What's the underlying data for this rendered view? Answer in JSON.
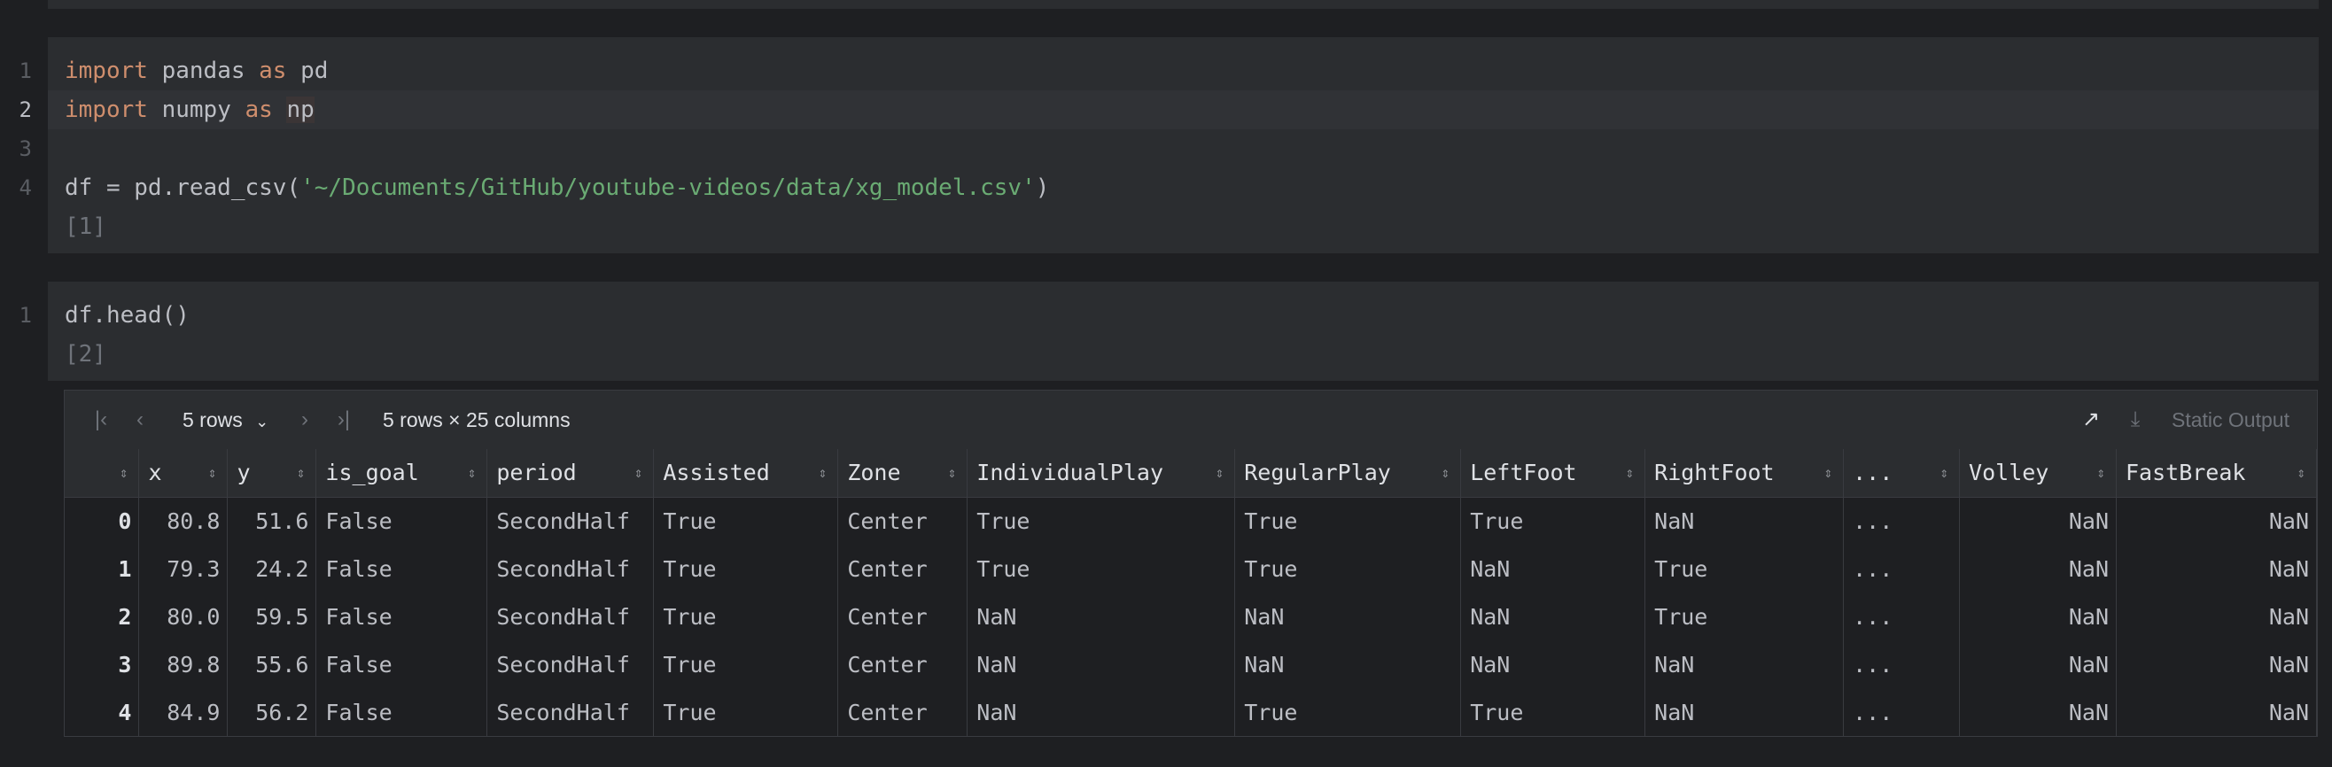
{
  "cell1": {
    "lines": [
      {
        "num": "1",
        "tokens": [
          [
            "kw",
            "import"
          ],
          [
            "",
            "pandas "
          ],
          [
            "kw",
            "as"
          ],
          [
            "",
            "pd"
          ]
        ]
      },
      {
        "num": "2",
        "tokens": [
          [
            "kw",
            "import"
          ],
          [
            "",
            "numpy "
          ],
          [
            "kw",
            "as"
          ],
          [
            "np",
            "np"
          ]
        ]
      },
      {
        "num": "3",
        "tokens": []
      },
      {
        "num": "4",
        "tokens": [
          [
            "",
            "df = pd.read_csv("
          ],
          [
            "str",
            "'~/Documents/GitHub/youtube-videos/data/xg_model.csv'"
          ],
          [
            "",
            ")"
          ]
        ]
      }
    ],
    "exec_count": "[1]"
  },
  "cell2": {
    "lines": [
      {
        "num": "1",
        "tokens": [
          [
            "",
            "df.head()"
          ]
        ]
      }
    ],
    "exec_count": "[2]"
  },
  "output": {
    "rows_selector": "5 rows",
    "shape_text": "5 rows × 25 columns",
    "static_output_label": "Static Output",
    "columns": [
      "",
      "x",
      "y",
      "is_goal",
      "period",
      "Assisted",
      "Zone",
      "IndividualPlay",
      "RegularPlay",
      "LeftFoot",
      "RightFoot",
      "...",
      "Volley",
      "FastBreak"
    ],
    "rows": [
      [
        "0",
        "80.8",
        "51.6",
        "False",
        "SecondHalf",
        "True",
        "Center",
        "True",
        "True",
        "True",
        "NaN",
        "...",
        "NaN",
        "NaN"
      ],
      [
        "1",
        "79.3",
        "24.2",
        "False",
        "SecondHalf",
        "True",
        "Center",
        "True",
        "True",
        "NaN",
        "True",
        "...",
        "NaN",
        "NaN"
      ],
      [
        "2",
        "80.0",
        "59.5",
        "False",
        "SecondHalf",
        "True",
        "Center",
        "NaN",
        "NaN",
        "NaN",
        "True",
        "...",
        "NaN",
        "NaN"
      ],
      [
        "3",
        "89.8",
        "55.6",
        "False",
        "SecondHalf",
        "True",
        "Center",
        "NaN",
        "NaN",
        "NaN",
        "NaN",
        "...",
        "NaN",
        "NaN"
      ],
      [
        "4",
        "84.9",
        "56.2",
        "False",
        "SecondHalf",
        "True",
        "Center",
        "NaN",
        "True",
        "True",
        "NaN",
        "...",
        "NaN",
        "NaN"
      ]
    ]
  },
  "icons": {
    "first_page": "first-page-icon",
    "prev_page": "prev-page-icon",
    "next_page": "next-page-icon",
    "last_page": "last-page-icon",
    "open_external": "open-external-icon",
    "download": "download-icon",
    "sort": "sort-icon"
  },
  "colors": {
    "background": "#1e1f22",
    "cell_background": "#2b2d30",
    "keyword": "#cf8e6d",
    "string": "#6aab73"
  }
}
